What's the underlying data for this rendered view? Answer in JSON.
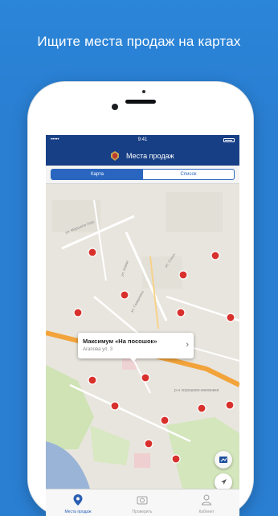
{
  "promo": {
    "headline": "Ищите места продаж на картах"
  },
  "status_bar": {
    "carrier": "•••••",
    "time": "9:41"
  },
  "nav": {
    "title": "Места продаж"
  },
  "segments": {
    "map_label": "Карта",
    "list_label": "Список"
  },
  "map": {
    "street_labels": [
      "ул. Маршала Груд",
      "ул. Новая",
      "ул. Гамарника",
      "ул. Сокол",
      "р-н хорошево-мневники"
    ],
    "callout": {
      "title": "Максимум «На посошок»",
      "address": "Агапова ул. 3"
    }
  },
  "tabs": [
    {
      "label": "Места продаж",
      "icon": "map-pin-icon",
      "active": true
    },
    {
      "label": "Проверить",
      "icon": "camera-icon",
      "active": false
    },
    {
      "label": "Кабинет",
      "icon": "person-icon",
      "active": false
    }
  ],
  "colors": {
    "brand_blue": "#173f85",
    "accent": "#2a66c0",
    "marker_red": "#d8302c",
    "background": "#2a7fd3"
  }
}
